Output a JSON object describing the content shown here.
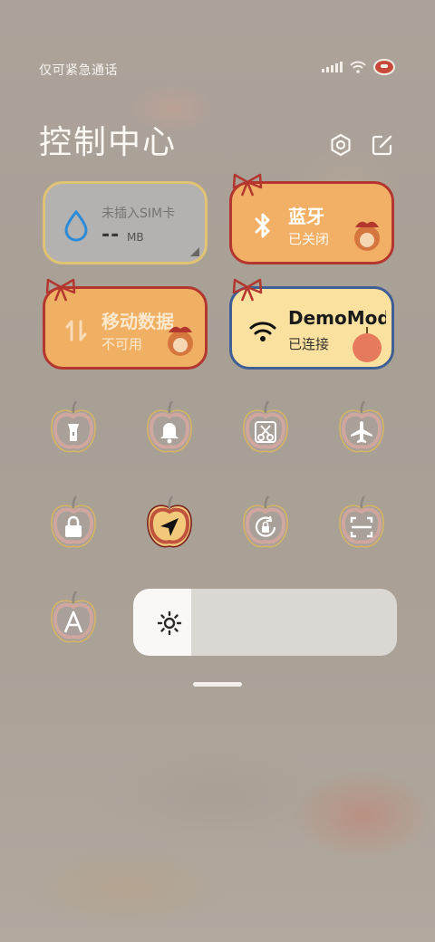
{
  "status_bar": {
    "carrier": "仅可紧急通话",
    "signal_icon": "signal-icon",
    "wifi_icon": "wifi-icon",
    "battery_icon": "battery-icon"
  },
  "header": {
    "title": "控制中心",
    "settings_icon": "settings-icon",
    "edit_icon": "edit-icon"
  },
  "tiles": {
    "sim": {
      "label": "未插入SIM卡",
      "value": "--",
      "unit": "MB",
      "icon": "water-drop-icon"
    },
    "bluetooth": {
      "title": "蓝牙",
      "status": "已关闭",
      "icon": "bluetooth-icon"
    },
    "mobile_data": {
      "title": "移动数据",
      "status": "不可用",
      "icon": "data-arrows-icon"
    },
    "wifi": {
      "title": "DemoMod",
      "status": "已连接",
      "icon": "wifi-icon"
    }
  },
  "toggles": [
    {
      "name": "flashlight",
      "icon": "flashlight-icon",
      "active": false
    },
    {
      "name": "ringer",
      "icon": "bell-icon",
      "active": false
    },
    {
      "name": "screenshot",
      "icon": "scissors-icon",
      "active": false
    },
    {
      "name": "airplane-mode",
      "icon": "airplane-icon",
      "active": false
    },
    {
      "name": "lock-screen",
      "icon": "lock-icon",
      "active": false
    },
    {
      "name": "location",
      "icon": "location-arrow-icon",
      "active": true
    },
    {
      "name": "auto-rotate",
      "icon": "rotate-lock-icon",
      "active": false
    },
    {
      "name": "scanner",
      "icon": "scan-icon",
      "active": false
    },
    {
      "name": "auto-brightness",
      "icon": "auto-brightness-icon",
      "active": false
    }
  ],
  "brightness": {
    "level_fraction": 0.22,
    "icon": "sun-icon"
  },
  "colors": {
    "tile_orange": "#f2b066",
    "tile_wifi": "#fbe1a0",
    "apple_red": "#b3362f",
    "accent_blue": "#2b8bd8"
  }
}
